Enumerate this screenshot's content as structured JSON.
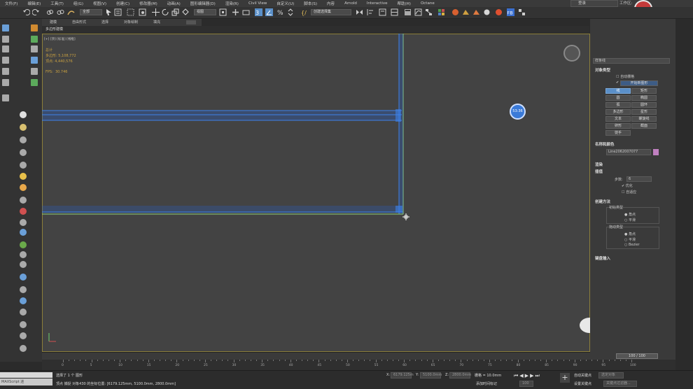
{
  "menu": [
    "文件(F)",
    "编辑(E)",
    "工具(T)",
    "组(G)",
    "视图(V)",
    "创建(C)",
    "修改器(M)",
    "动画(A)",
    "图形编辑器(D)",
    "渲染(R)",
    "Civil View",
    "自定义(U)",
    "脚本(S)",
    "内容",
    "Arnold",
    "Interactive",
    "帮助(H)",
    "Octane"
  ],
  "login": "登录",
  "workspace_label": "工作区:",
  "toolbar": {
    "filter": "全部",
    "view": "视图",
    "selection_set": "创建选择集"
  },
  "ribbon_tabs": [
    "建模",
    "自由形式",
    "选择",
    "对象绘制",
    "填充"
  ],
  "subtab": "多边形建模",
  "viewport": {
    "label": "[+] [顶] [标准] [线框]",
    "stats": {
      "title": "总计",
      "polys_label": "多边形:",
      "polys": "5,108,772",
      "verts_label": "顶点:",
      "verts": "4,440,576"
    },
    "fps_label": "FPS:",
    "fps": "30.746",
    "time_badge": "53:36"
  },
  "right_panel": {
    "dropdown": "样条线",
    "object_type_title": "对象类型",
    "auto_grid": "自动栅格",
    "start_new_shape": "开始新图形",
    "buttons": [
      "线",
      "矩形",
      "圆",
      "椭圆",
      "弧",
      "圆环",
      "多边形",
      "星形",
      "文本",
      "螺旋线",
      "卵形",
      "截面",
      "徒手"
    ],
    "name_color_title": "名称和颜色",
    "object_name": "Line2062007077",
    "name_swatch_color": "#c080c0",
    "render_title": "渲染",
    "interp_title": "插值",
    "steps_label": "步数:",
    "steps_value": "6",
    "optimize": "优化",
    "adaptive": "自适应",
    "creation_title": "创建方法",
    "initial_type": "初始类型",
    "initial_opts": [
      "角点",
      "平滑"
    ],
    "drag_type": "拖动类型",
    "drag_opts": [
      "角点",
      "平滑",
      "Bezier"
    ],
    "keyboard_title": "键盘输入"
  },
  "timeline": {
    "frame": "100 / 100",
    "ticks": [
      "0",
      "5",
      "10",
      "15",
      "20",
      "25",
      "30",
      "35",
      "40",
      "45",
      "50",
      "55",
      "60",
      "65",
      "70",
      "75",
      "80",
      "85",
      "90",
      "95",
      "100"
    ]
  },
  "status": {
    "maxscript": "MAXScript 迷",
    "selected": "选择了 1 个 图形",
    "prompt": "顶点 捕捉 对象430 的坐标位置: [6179.125mm, 5100.0mm, 2800.0mm]",
    "x_label": "X:",
    "x": "6179.125m",
    "y_label": "Y:",
    "y": "5100.0mm",
    "z_label": "Z:",
    "z": "2800.0mm",
    "grid": "栅格 = 10.0mm",
    "add_time_tag": "添加时间标记",
    "auto_key": "自动关键点",
    "selected_obj": "选定对象",
    "set_key": "设置关键点",
    "key_filter": "关键点过滤器...",
    "frame": "100"
  },
  "colors": {
    "accent_blue": "#2f6fd8",
    "guide_green": "#8fd27a",
    "record_red": "#c43a3a"
  }
}
